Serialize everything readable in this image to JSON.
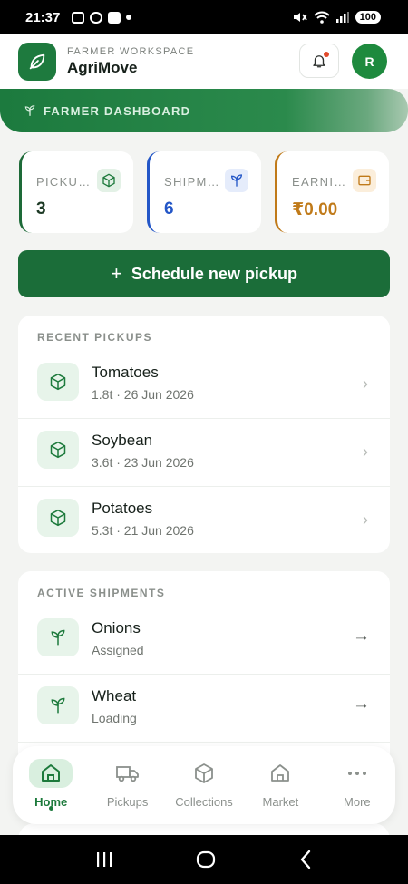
{
  "status_bar": {
    "time": "21:37",
    "battery": "100"
  },
  "header": {
    "subtitle": "FARMER WORKSPACE",
    "title": "AgriMove",
    "avatar_initial": "R"
  },
  "banner": {
    "label": "FARMER DASHBOARD"
  },
  "stats": [
    {
      "label": "PICKUPS",
      "value": "3",
      "color": "#1d6a38",
      "icon": "package-icon"
    },
    {
      "label": "SHIPMENTS",
      "value": "6",
      "color": "#2356c7",
      "icon": "sprout-icon"
    },
    {
      "label": "EARNINGS",
      "value": "₹0.00",
      "color": "#c07a19",
      "icon": "wallet-icon"
    }
  ],
  "schedule_button": {
    "label": "Schedule new pickup"
  },
  "recent_pickups": {
    "title": "RECENT PICKUPS",
    "items": [
      {
        "name": "Tomatoes",
        "meta": "1.8t · 26 Jun 2026"
      },
      {
        "name": "Soybean",
        "meta": "3.6t · 23 Jun 2026"
      },
      {
        "name": "Potatoes",
        "meta": "5.3t · 21 Jun 2026"
      }
    ]
  },
  "active_shipments": {
    "title": "ACTIVE SHIPMENTS",
    "items": [
      {
        "name": "Onions",
        "status": "Assigned"
      },
      {
        "name": "Wheat",
        "status": "Loading"
      }
    ]
  },
  "tabs": [
    {
      "label": "Home",
      "icon": "home-icon",
      "active": true
    },
    {
      "label": "Pickups",
      "icon": "truck-icon",
      "active": false
    },
    {
      "label": "Collections",
      "icon": "package-icon",
      "active": false
    },
    {
      "label": "Market",
      "icon": "store-icon",
      "active": false
    },
    {
      "label": "More",
      "icon": "more-icon",
      "active": false
    }
  ]
}
